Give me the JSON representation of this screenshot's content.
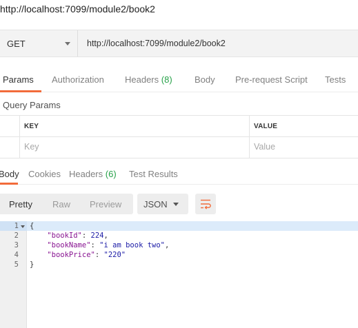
{
  "window": {
    "title": "http://localhost:7099/module2/book2"
  },
  "request": {
    "method": "GET",
    "url": "http://localhost:7099/module2/book2"
  },
  "request_tabs": [
    {
      "label": "Params"
    },
    {
      "label": "Authorization"
    },
    {
      "label": "Headers",
      "count": "(8)"
    },
    {
      "label": "Body"
    },
    {
      "label": "Pre-request Script"
    },
    {
      "label": "Tests"
    }
  ],
  "query_params": {
    "title": "Query Params",
    "key_header": "KEY",
    "value_header": "VALUE",
    "key_placeholder": "Key",
    "value_placeholder": "Value"
  },
  "response_tabs": [
    {
      "label": "Body"
    },
    {
      "label": "Cookies"
    },
    {
      "label": "Headers",
      "count": "(6)"
    },
    {
      "label": "Test Results"
    }
  ],
  "view": {
    "modes": [
      "Pretty",
      "Raw",
      "Preview"
    ],
    "format": "JSON"
  },
  "code": {
    "line_numbers": [
      "1",
      "2",
      "3",
      "4",
      "5"
    ],
    "lines": {
      "open": "{",
      "key1": "\"bookId\"",
      "val1": "224",
      "key2": "\"bookName\"",
      "val2": "\"i am book two\"",
      "key3": "\"bookPrice\"",
      "val3": "\"220\"",
      "close": "}"
    },
    "colors": {
      "key": "#881391",
      "string": "#1a1aa6",
      "active_line": "#dcebfa"
    }
  },
  "colors": {
    "accent": "#f26b3a",
    "count_green": "#26a148"
  }
}
